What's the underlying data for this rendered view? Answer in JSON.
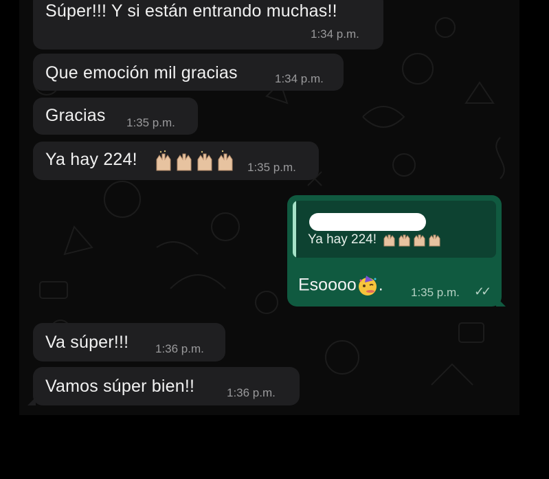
{
  "messages": [
    {
      "text": "Súper!!! Y si están entrando muchas!!",
      "time": "1:34 p.m."
    },
    {
      "text": "Que emoción mil gracias",
      "time": "1:34 p.m."
    },
    {
      "text": "Gracias",
      "time": "1:35 p.m."
    },
    {
      "text": "Ya hay 224!",
      "time": "1:35 p.m.",
      "emoji": "raising-hands-icon"
    },
    {
      "text": "Va súper!!!",
      "time": "1:36 p.m."
    },
    {
      "text": "Vamos súper bien!!",
      "time": "1:36 p.m."
    }
  ],
  "outgoing": {
    "reply_quote": "Ya hay 224!",
    "text": "Esoooo",
    "suffix": ".",
    "time": "1:35 p.m.",
    "status_icon": "double-check-icon",
    "emoji": "partying-face-icon"
  },
  "colors": {
    "background": "#0b0b0b",
    "incoming_bubble": "#1f1f21",
    "outgoing_bubble": "#105a40",
    "quote_bar": "#a5e3c8"
  }
}
